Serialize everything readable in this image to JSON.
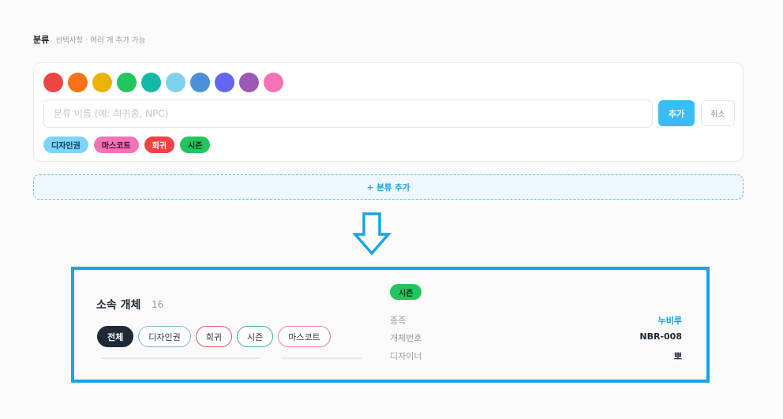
{
  "section": {
    "title": "분류",
    "hint": "선택사항 · 여러 개 추가 가능"
  },
  "colors": [
    "#ef4444",
    "#f97316",
    "#eab308",
    "#22c55e",
    "#14b8a6",
    "#7dd3eb",
    "#4a90d9",
    "#6366f1",
    "#9b59b6",
    "#f472b6"
  ],
  "form": {
    "placeholder": "분류 이름 (예: 희귀종, NPC)",
    "add_label": "추가",
    "cancel_label": "취소"
  },
  "tags": [
    "디자인권",
    "마스코트",
    "희귀",
    "시즌"
  ],
  "add_category_label": "+ 분류 추가",
  "preview": {
    "title": "소속 개체",
    "count": "16",
    "filters": [
      "전체",
      "디자인권",
      "희귀",
      "시즌",
      "마스코트"
    ],
    "badge": "시즌",
    "details": [
      {
        "key": "종족",
        "value": "누비루"
      },
      {
        "key": "개체번호",
        "value": "NBR-008"
      },
      {
        "key": "디자이너",
        "value": "뽀"
      }
    ]
  }
}
